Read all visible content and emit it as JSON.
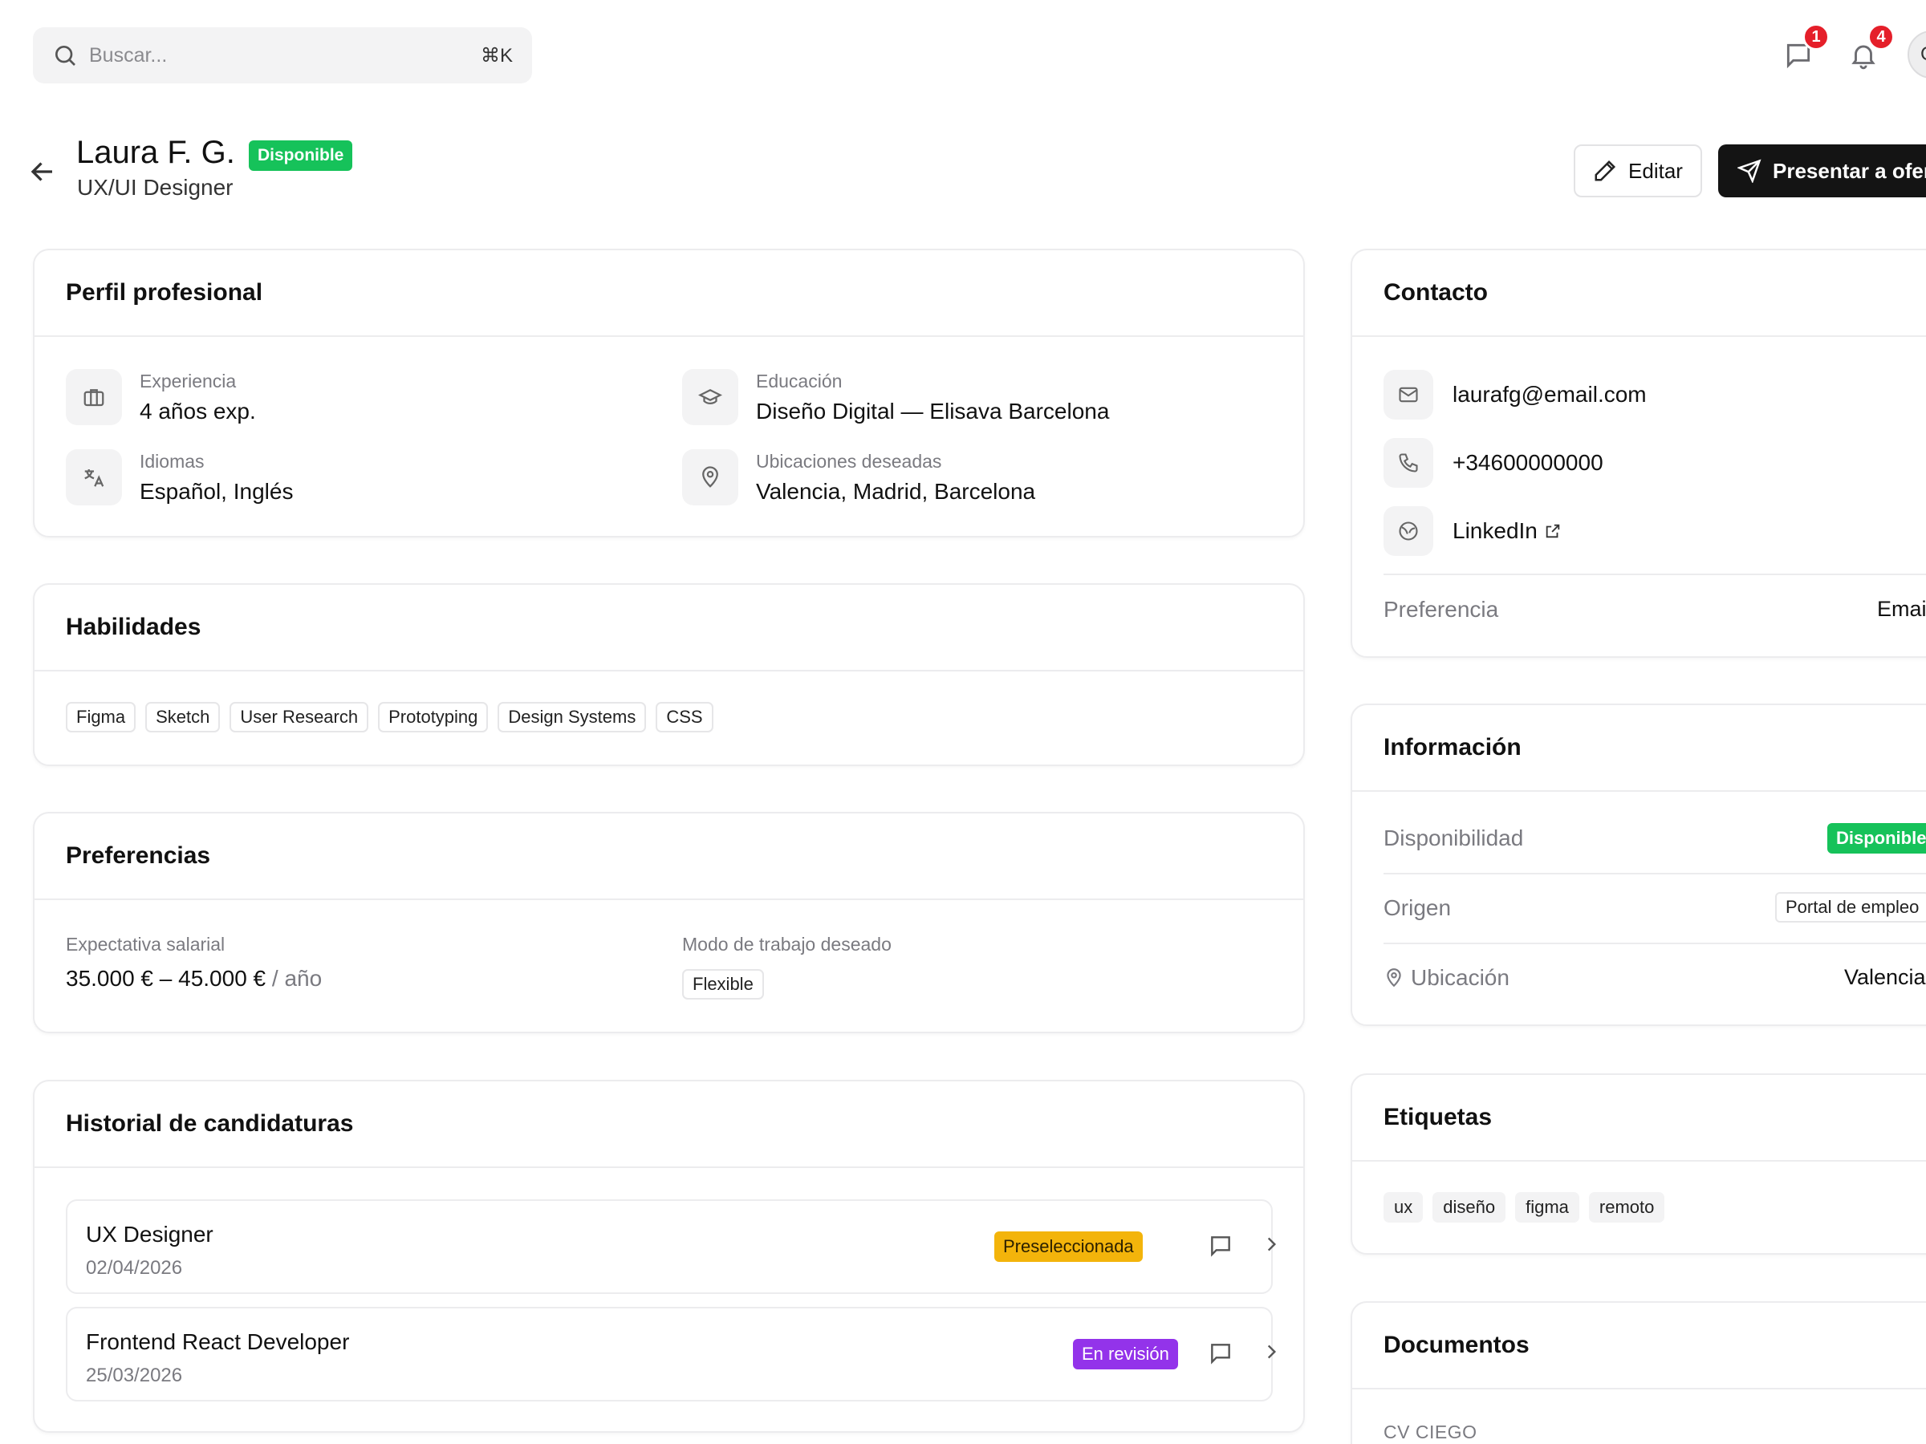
{
  "search": {
    "placeholder": "Buscar...",
    "shortcut": "⌘K"
  },
  "topbar": {
    "messages_count": "1",
    "notifications_count": "4",
    "avatar_initial": "C"
  },
  "candidate": {
    "name": "Laura F. G.",
    "status": "Disponible",
    "role": "UX/UI Designer"
  },
  "actions": {
    "edit": "Editar",
    "present": "Presentar a ofer"
  },
  "profile": {
    "title": "Perfil profesional",
    "experience_label": "Experiencia",
    "experience_value": "4 años exp.",
    "education_label": "Educación",
    "education_value": "Diseño Digital — Elisava Barcelona",
    "languages_label": "Idiomas",
    "languages_value": "Español, Inglés",
    "locations_label": "Ubicaciones deseadas",
    "locations_value": "Valencia, Madrid, Barcelona"
  },
  "skills": {
    "title": "Habilidades",
    "items": [
      "Figma",
      "Sketch",
      "User Research",
      "Prototyping",
      "Design Systems",
      "CSS"
    ]
  },
  "preferences": {
    "title": "Preferencias",
    "salary_label": "Expectativa salarial",
    "salary_value": "35.000 € – 45.000 €",
    "salary_unit": "/ año",
    "mode_label": "Modo de trabajo deseado",
    "mode_value": "Flexible"
  },
  "history": {
    "title": "Historial de candidaturas",
    "items": [
      {
        "title": "UX Designer",
        "date": "02/04/2026",
        "status": "Preseleccionada"
      },
      {
        "title": "Frontend React Developer",
        "date": "25/03/2026",
        "status": "En revisión"
      }
    ]
  },
  "contact": {
    "title": "Contacto",
    "email": "laurafg@email.com",
    "phone": "+34600000000",
    "linkedin": "LinkedIn",
    "preference_label": "Preferencia",
    "preference_value": "Emai"
  },
  "info": {
    "title": "Información",
    "availability_label": "Disponibilidad",
    "availability_value": "Disponible",
    "origin_label": "Origen",
    "origin_value": "Portal de empleo",
    "location_label": "Ubicación",
    "location_value": "Valencia"
  },
  "tags": {
    "title": "Etiquetas",
    "items": [
      "ux",
      "diseño",
      "figma",
      "remoto"
    ]
  },
  "documents": {
    "title": "Documentos",
    "cv_label": "CV CIEGO"
  },
  "colors": {
    "available_green": "#16c25a",
    "badge_red": "#e51f2a",
    "shortlisted_yellow": "#f3b40b",
    "review_purple": "#9333ea",
    "primary_button": "#141414"
  }
}
